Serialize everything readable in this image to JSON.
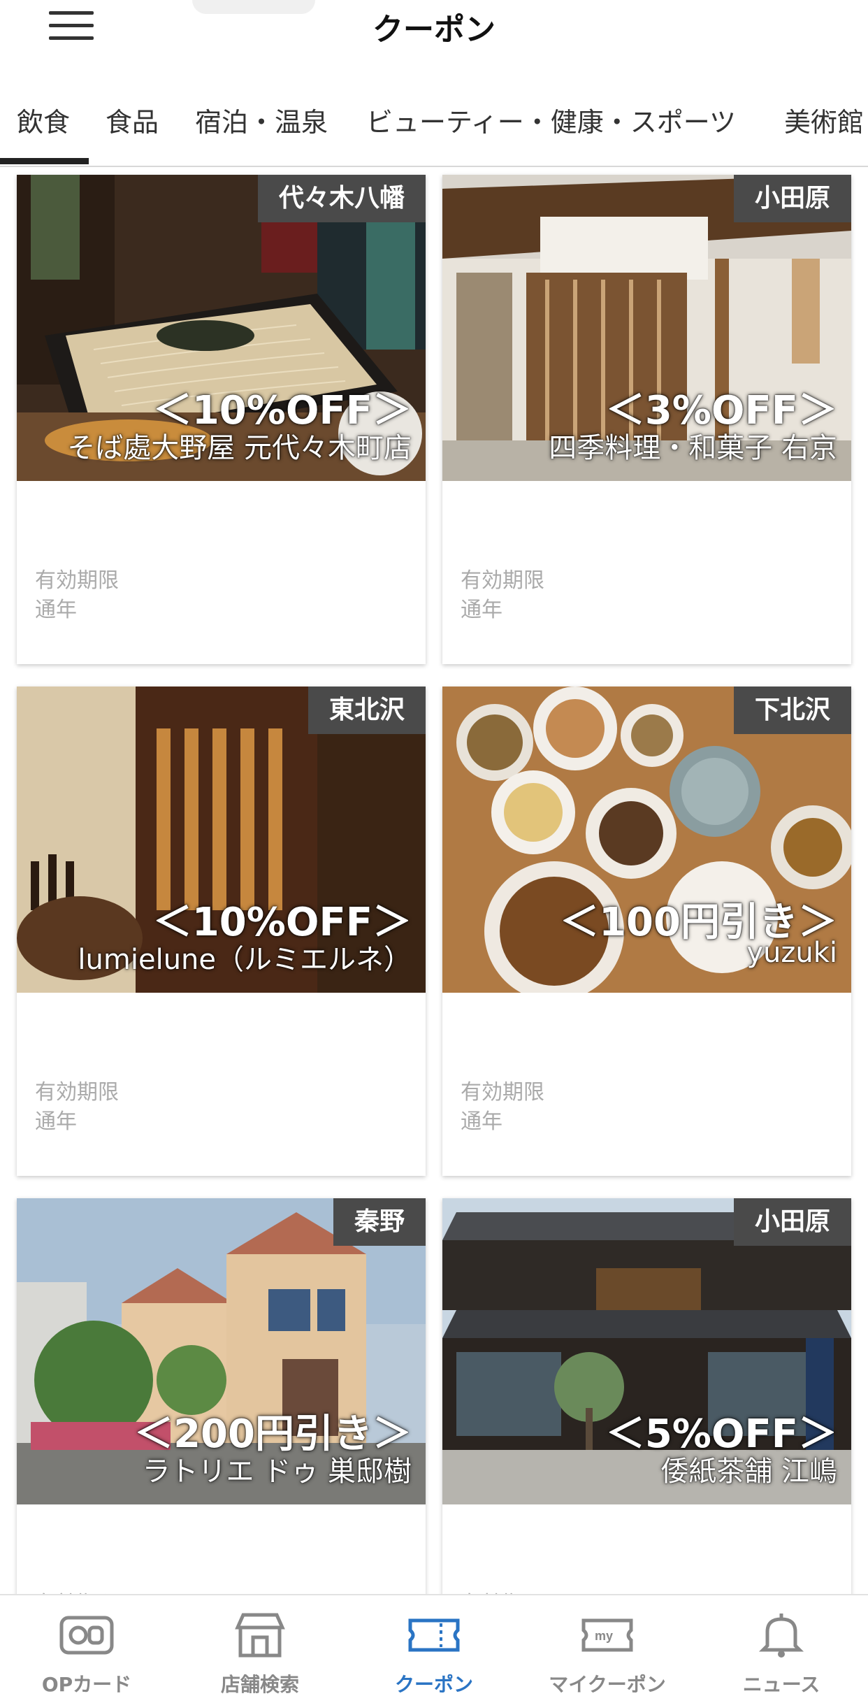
{
  "header": {
    "title": "クーポン"
  },
  "tabs": [
    {
      "label": "飲食",
      "active": true
    },
    {
      "label": "食品"
    },
    {
      "label": "宿泊・温泉"
    },
    {
      "label": "ビューティー・健康・スポーツ"
    },
    {
      "label": "美術館"
    }
  ],
  "coupons": [
    {
      "area": "代々木八幡",
      "discount": "＜10%OFF＞",
      "shop": "そば處大野屋 元代々木町店",
      "validity_label": "有効期限",
      "validity_value": "通年"
    },
    {
      "area": "小田原",
      "discount": "＜3%OFF＞",
      "shop": "四季料理・和菓子 右京",
      "validity_label": "有効期限",
      "validity_value": "通年"
    },
    {
      "area": "東北沢",
      "discount": "＜10%OFF＞",
      "shop": "lumielune（ルミエルネ）",
      "validity_label": "有効期限",
      "validity_value": "通年"
    },
    {
      "area": "下北沢",
      "discount": "＜100円引き＞",
      "shop": "yuzuki",
      "validity_label": "有効期限",
      "validity_value": "通年"
    },
    {
      "area": "秦野",
      "discount": "＜200円引き＞",
      "shop": "ラトリエ ドゥ 巣邸樹",
      "validity_label": "有効期限",
      "validity_value": ""
    },
    {
      "area": "小田原",
      "discount": "＜5%OFF＞",
      "shop": "倭紙茶舗 江嶋",
      "validity_label": "有効期限",
      "validity_value": ""
    }
  ],
  "bottom_nav": [
    {
      "label": "OPカード",
      "icon": "op-card-icon"
    },
    {
      "label": "店舗検索",
      "icon": "store-icon"
    },
    {
      "label": "クーポン",
      "icon": "coupon-ticket-icon",
      "active": true
    },
    {
      "label": "マイクーポン",
      "icon": "my-coupon-icon"
    },
    {
      "label": "ニュース",
      "icon": "bell-icon"
    }
  ],
  "colors": {
    "active_nav": "#2a74c4",
    "badge_bg": "#4a4a4a",
    "inactive": "#888888"
  }
}
